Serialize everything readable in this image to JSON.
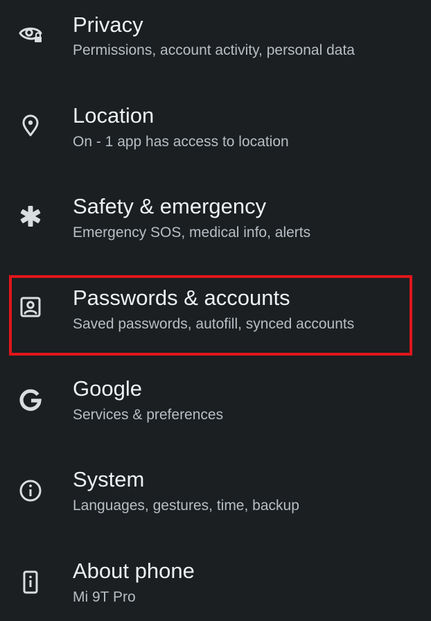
{
  "settings": {
    "items": [
      {
        "icon": "privacy-eye-lock-icon",
        "title": "Privacy",
        "subtitle": "Permissions, account activity, personal data"
      },
      {
        "icon": "location-pin-icon",
        "title": "Location",
        "subtitle": "On - 1 app has access to location"
      },
      {
        "icon": "asterisk-emergency-icon",
        "title": "Safety & emergency",
        "subtitle": "Emergency SOS, medical info, alerts"
      },
      {
        "icon": "account-box-icon",
        "title": "Passwords & accounts",
        "subtitle": "Saved passwords, autofill, synced accounts"
      },
      {
        "icon": "google-g-icon",
        "title": "Google",
        "subtitle": "Services & preferences"
      },
      {
        "icon": "info-circle-icon",
        "title": "System",
        "subtitle": "Languages, gestures, time, backup"
      },
      {
        "icon": "phone-info-icon",
        "title": "About phone",
        "subtitle": "Mi 9T Pro"
      }
    ]
  },
  "colors": {
    "background": "#1b1f22",
    "title": "#eef1f3",
    "subtitle": "#b7bec4",
    "icon": "#d9dde0",
    "highlight": "#e0161b"
  }
}
